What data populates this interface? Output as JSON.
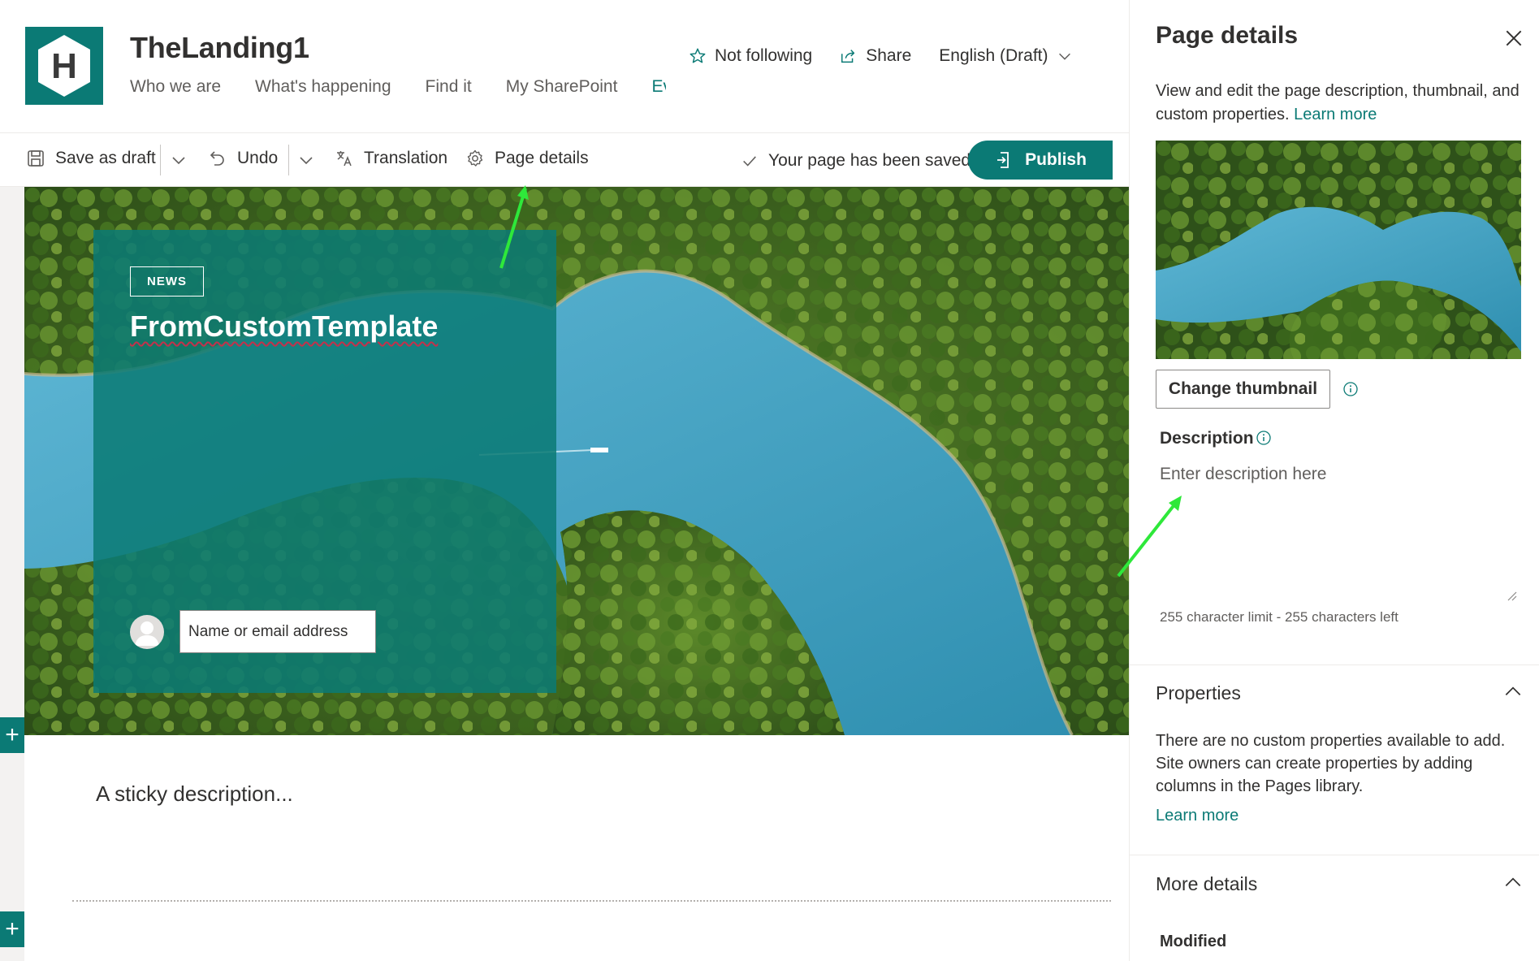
{
  "site": {
    "title": "TheLanding1",
    "logo_letter": "H",
    "brand_color": "#0b7a75",
    "nav": [
      "Who we are",
      "What's happening",
      "Find it",
      "My SharePoint",
      "Ev"
    ],
    "follow_label": "Not following",
    "share_label": "Share",
    "language_label": "English (Draft)"
  },
  "command_bar": {
    "save_draft_label": "Save as draft",
    "undo_label": "Undo",
    "translation_label": "Translation",
    "page_details_label": "Page details",
    "saved_status": "Your page has been saved",
    "publish_label": "Publish"
  },
  "hero": {
    "tag": "NEWS",
    "title": "FromCustomTemplate",
    "author_placeholder": "Name or email address"
  },
  "body": {
    "description": "A sticky description..."
  },
  "panel": {
    "title": "Page details",
    "intro": "View and edit the page description, thumbnail, and custom properties.",
    "intro_link": "Learn more",
    "change_thumbnail_label": "Change thumbnail",
    "description_label": "Description",
    "description_placeholder": "Enter description here",
    "char_limit": "255 character limit - 255 characters left",
    "properties_heading": "Properties",
    "properties_text": "There are no custom properties available to add. Site owners can create properties by adding columns in the Pages library.",
    "properties_link": "Learn more",
    "more_details_heading": "More details",
    "modified_label": "Modified"
  },
  "icons": {
    "star": "star-icon",
    "share": "share-icon",
    "chevron": "chevron-down-icon",
    "save": "save-icon",
    "undo": "undo-icon",
    "translation": "translation-icon",
    "gear": "gear-icon",
    "check": "checkmark-icon",
    "publish": "publish-icon",
    "close": "close-icon",
    "info": "info-icon",
    "add": "add-icon"
  },
  "annotation_color": "#2ee83a"
}
